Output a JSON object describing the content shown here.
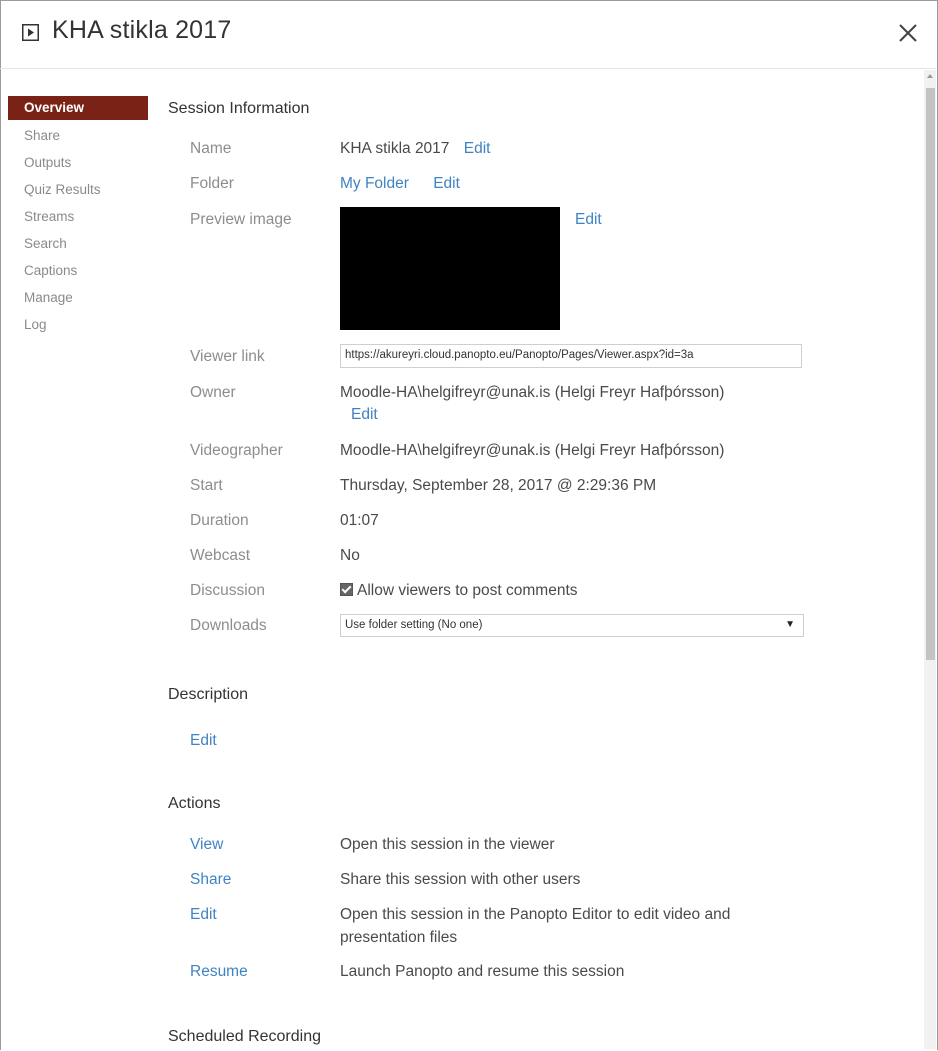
{
  "window": {
    "title": "KHA stikla 2017",
    "icon": "play-box-icon",
    "close_icon": "close-icon"
  },
  "sidebar": {
    "items": [
      {
        "label": "Overview",
        "active": true
      },
      {
        "label": "Share",
        "active": false
      },
      {
        "label": "Outputs",
        "active": false
      },
      {
        "label": "Quiz Results",
        "active": false
      },
      {
        "label": "Streams",
        "active": false
      },
      {
        "label": "Search",
        "active": false
      },
      {
        "label": "Captions",
        "active": false
      },
      {
        "label": "Manage",
        "active": false
      },
      {
        "label": "Log",
        "active": false
      }
    ],
    "active_color": "#7b2216"
  },
  "session_info": {
    "heading": "Session Information",
    "name_label": "Name",
    "name_value": "KHA stikla 2017",
    "name_edit": "Edit",
    "folder_label": "Folder",
    "folder_value": "My Folder",
    "folder_edit": "Edit",
    "preview_label": "Preview image",
    "preview_edit": "Edit",
    "viewer_label": "Viewer link",
    "viewer_value": "https://akureyri.cloud.panopto.eu/Panopto/Pages/Viewer.aspx?id=3a",
    "owner_label": "Owner",
    "owner_value": "Moodle-HA\\helgifreyr@unak.is (Helgi Freyr Hafþórsson)",
    "owner_edit": "Edit",
    "videographer_label": "Videographer",
    "videographer_value": "Moodle-HA\\helgifreyr@unak.is (Helgi Freyr Hafþórsson)",
    "start_label": "Start",
    "start_value": "Thursday, September 28, 2017 @ 2:29:36 PM",
    "duration_label": "Duration",
    "duration_value": "01:07",
    "webcast_label": "Webcast",
    "webcast_value": "No",
    "discussion_label": "Discussion",
    "discussion_value": "Allow viewers to post comments",
    "discussion_checked": true,
    "downloads_label": "Downloads",
    "downloads_value": "Use folder setting (No one)"
  },
  "description": {
    "heading": "Description",
    "edit": "Edit"
  },
  "actions": {
    "heading": "Actions",
    "items": [
      {
        "link": "View",
        "text": "Open this session in the viewer"
      },
      {
        "link": "Share",
        "text": "Share this session with other users"
      },
      {
        "link": "Edit",
        "text": "Open this session in the Panopto Editor to edit video and",
        "text2": "presentation files"
      },
      {
        "link": "Resume",
        "text": "Launch Panopto and resume this session"
      }
    ]
  },
  "scheduled": {
    "heading": "Scheduled Recording"
  },
  "colors": {
    "link": "#3f83c4",
    "label": "#8d8d8d"
  }
}
